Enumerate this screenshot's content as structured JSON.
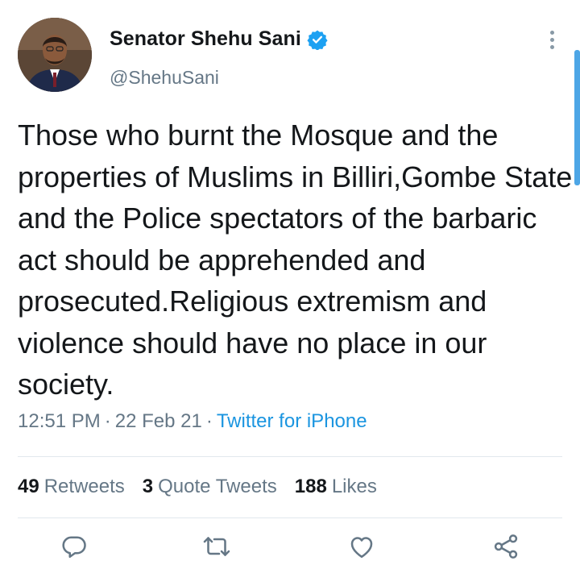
{
  "author": {
    "display_name": "Senator Shehu Sani",
    "handle": "@ShehuSani",
    "verified": true,
    "avatar_icon": "profile-photo"
  },
  "tweet": {
    "text": "Those who burnt the Mosque and the properties of Muslims in Billiri,Gombe State and the Police spectators of the barbaric act should be apprehended and prosecuted.Religious extremism and violence should have no place in our society.",
    "time": "12:51 PM",
    "date": "22 Feb 21",
    "separator": "·",
    "source": "Twitter for iPhone"
  },
  "stats": {
    "retweets_count": "49",
    "retweets_label": "Retweets",
    "quotes_count": "3",
    "quotes_label": "Quote Tweets",
    "likes_count": "188",
    "likes_label": "Likes"
  },
  "actions": [
    "reply-icon",
    "retweet-icon",
    "like-icon",
    "share-icon"
  ],
  "colors": {
    "text": "#14171a",
    "secondary": "#657786",
    "accent": "#1b95e0",
    "icon": "#657786",
    "verified": "#1da1f2"
  }
}
